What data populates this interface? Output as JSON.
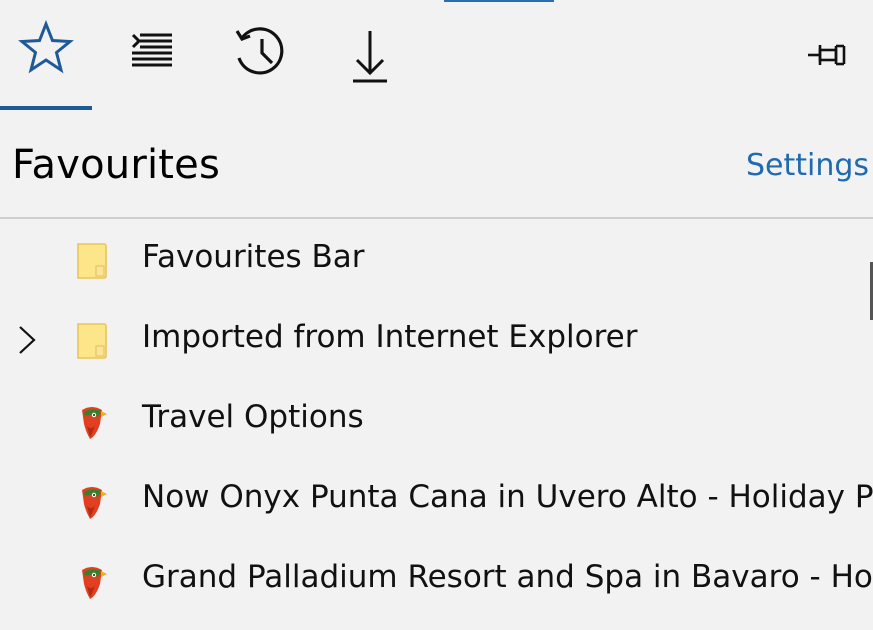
{
  "tabs": [
    {
      "id": "favourites",
      "icon": "star-icon",
      "selected": true
    },
    {
      "id": "reading-list",
      "icon": "reading-list-icon",
      "selected": false
    },
    {
      "id": "history",
      "icon": "history-icon",
      "selected": false
    },
    {
      "id": "downloads",
      "icon": "download-icon",
      "selected": false
    }
  ],
  "pin_icon": "pin-icon",
  "header": {
    "title": "Favourites",
    "settings_label": "Settings"
  },
  "items": [
    {
      "label": "Favourites Bar",
      "icon": "folder-icon",
      "expandable": false
    },
    {
      "label": "Imported from Internet Explorer",
      "icon": "folder-icon",
      "expandable": true
    },
    {
      "label": "Travel Options",
      "icon": "parrot-favicon-icon",
      "expandable": false
    },
    {
      "label": "Now Onyx Punta Cana in Uvero Alto - Holiday Pirates",
      "icon": "parrot-favicon-icon",
      "expandable": false
    },
    {
      "label": "Grand Palladium Resort and Spa in Bavaro - Holiday Pirates",
      "icon": "parrot-favicon-icon",
      "expandable": false
    }
  ],
  "colors": {
    "accent": "#1f5a98",
    "link": "#1f6ab0",
    "background": "#f2f2f2",
    "folder": "#fde689"
  }
}
